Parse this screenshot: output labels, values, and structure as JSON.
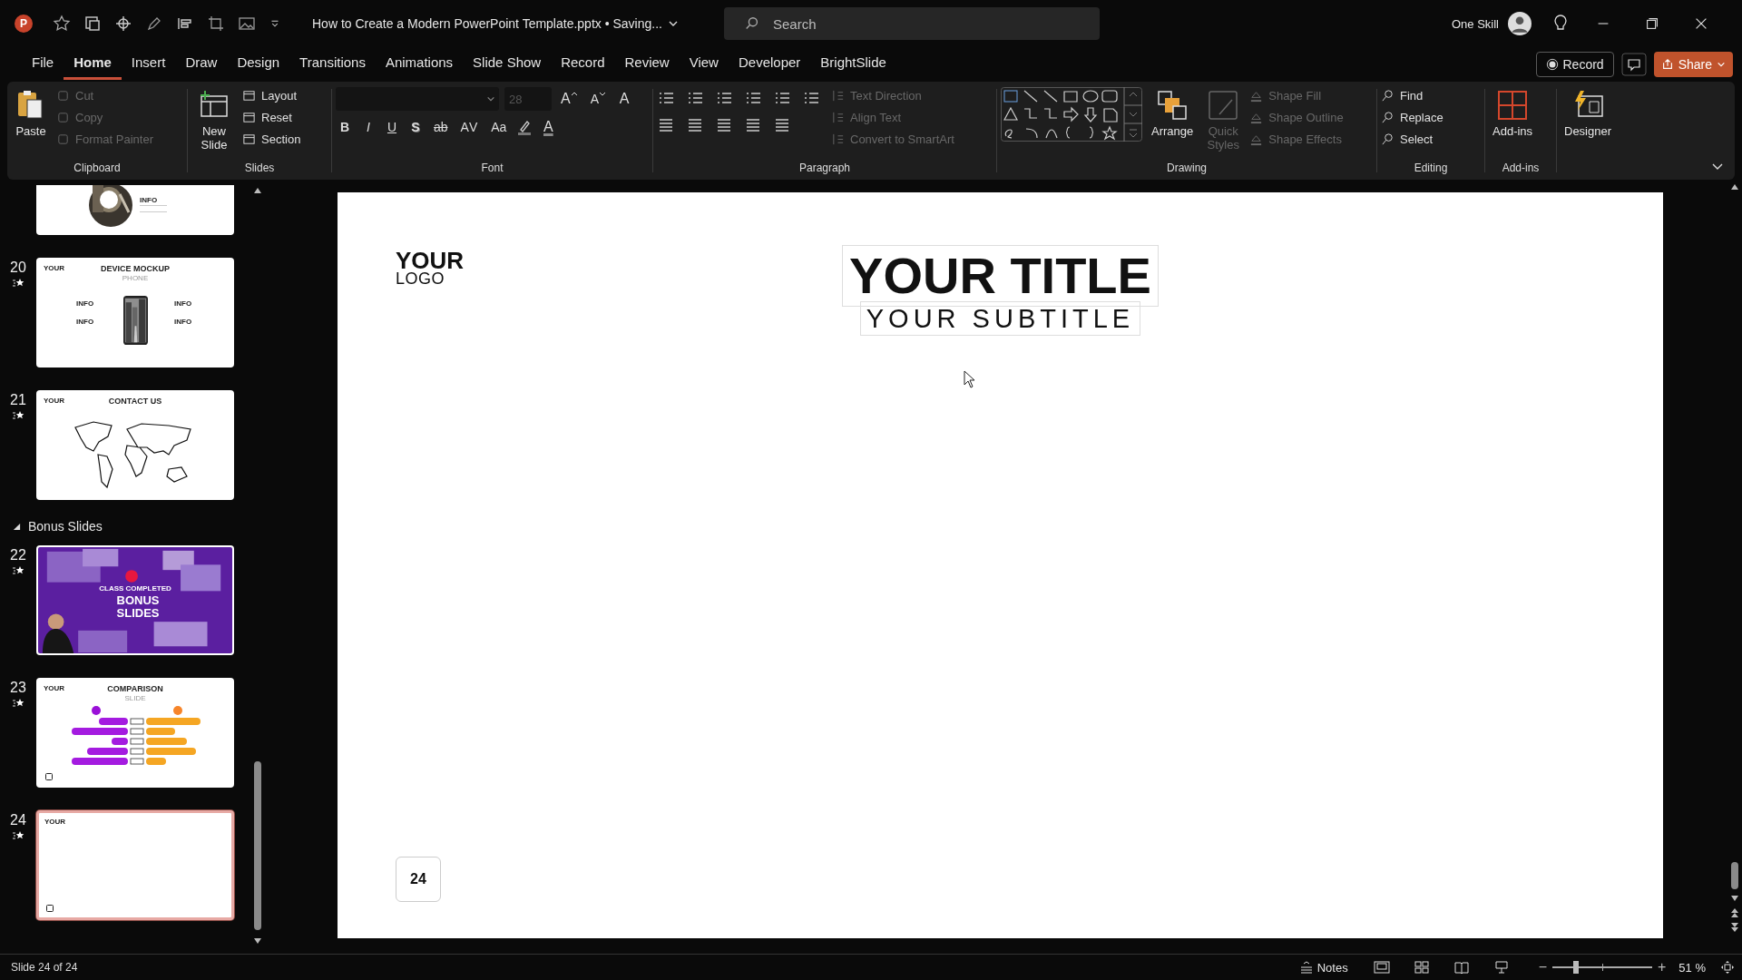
{
  "title_bar": {
    "app_logo": "P",
    "title": "How to Create a Modern PowerPoint Template.pptx • Saving...",
    "user": "One Skill"
  },
  "search": {
    "placeholder": "Search"
  },
  "menu_tabs": [
    {
      "label": "File",
      "selected": false
    },
    {
      "label": "Home",
      "selected": true
    },
    {
      "label": "Insert",
      "selected": false
    },
    {
      "label": "Draw",
      "selected": false
    },
    {
      "label": "Design",
      "selected": false
    },
    {
      "label": "Transitions",
      "selected": false
    },
    {
      "label": "Animations",
      "selected": false
    },
    {
      "label": "Slide Show",
      "selected": false
    },
    {
      "label": "Record",
      "selected": false
    },
    {
      "label": "Review",
      "selected": false
    },
    {
      "label": "View",
      "selected": false
    },
    {
      "label": "Developer",
      "selected": false
    },
    {
      "label": "BrightSlide",
      "selected": false
    }
  ],
  "record_button": "Record",
  "share_button": "Share",
  "ribbon": {
    "clipboard": {
      "label": "Clipboard",
      "paste": "Paste",
      "tools": [
        {
          "label": "Cut",
          "disabled": true
        },
        {
          "label": "Copy",
          "disabled": true
        },
        {
          "label": "Format Painter",
          "disabled": true
        }
      ]
    },
    "slides": {
      "label": "Slides",
      "new_slide": "New Slide",
      "tools": [
        {
          "label": "Layout",
          "disabled": false
        },
        {
          "label": "Reset",
          "disabled": false
        },
        {
          "label": "Section",
          "disabled": false
        }
      ]
    },
    "font": {
      "label": "Font",
      "size": {
        "value": "28",
        "disabled": true
      },
      "grow": "A",
      "shrink": "A",
      "clear": "A",
      "styles": [
        {
          "label": "B",
          "kind": "bold"
        },
        {
          "label": "I",
          "kind": "italic"
        },
        {
          "label": "U",
          "kind": "underline"
        },
        {
          "label": "S",
          "kind": "shadow"
        },
        {
          "label": "ab",
          "kind": "strike"
        },
        {
          "label": "AV",
          "kind": "spacing"
        },
        {
          "label": "Aa",
          "kind": "case"
        }
      ],
      "font_color": "A"
    },
    "paragraph": {
      "label": "Paragraph",
      "tools": [
        {
          "label": "Text Direction",
          "disabled": true
        },
        {
          "label": "Align Text",
          "disabled": true
        },
        {
          "label": "Convert to SmartArt",
          "disabled": true
        }
      ]
    },
    "drawing": {
      "label": "Drawing",
      "arrange": {
        "label": "Arrange",
        "disabled": false
      },
      "quick_styles": {
        "label": "Quick Styles",
        "disabled": true
      },
      "tools": [
        {
          "label": "Shape Fill",
          "disabled": true
        },
        {
          "label": "Shape Outline",
          "disabled": true
        },
        {
          "label": "Shape Effects",
          "disabled": true
        }
      ]
    },
    "editing": {
      "label": "Editing",
      "tools": [
        {
          "label": "Find"
        },
        {
          "label": "Replace"
        },
        {
          "label": "Select"
        }
      ]
    },
    "addins": {
      "label": "Add-ins",
      "button": "Add-ins"
    },
    "designer": "Designer"
  },
  "slide_panel": {
    "items": [
      {
        "kind": "info",
        "selected": false,
        "texts": [
          "INFO"
        ]
      },
      {
        "kind": "device",
        "number": "20",
        "selected": false,
        "logo": "YOUR",
        "title": "DEVICE MOCKUP",
        "subtitle": "PHONE",
        "texts": [
          "INFO",
          "INFO",
          "INFO",
          "INFO"
        ]
      },
      {
        "kind": "map",
        "number": "21",
        "selected": false,
        "logo": "YOUR",
        "title": "CONTACT US"
      },
      {
        "kind": "section",
        "label": "Bonus Slides",
        "expanded": true
      },
      {
        "kind": "bonus",
        "number": "22",
        "selected": false,
        "kicker": "CLASS COMPLETED",
        "title": "BONUS SLIDES"
      },
      {
        "kind": "comparison",
        "number": "23",
        "selected": false,
        "logo": "YOUR",
        "title": "COMPARISON",
        "subtitle": "SLIDE"
      },
      {
        "kind": "blank",
        "number": "24",
        "selected": true,
        "logo": "YOUR"
      }
    ]
  },
  "slide": {
    "logo_top": "YOUR",
    "logo_bottom": "LOGO",
    "title": "YOUR TITLE",
    "subtitle": "YOUR SUBTITLE",
    "page_number": "24"
  },
  "status_bar": {
    "slide_count": "Slide 24 of 24",
    "notes": "Notes",
    "zoom_out": "−",
    "zoom": {
      "level": 0.24
    },
    "zoom_in": "+",
    "zoom_percent": "51 %"
  }
}
